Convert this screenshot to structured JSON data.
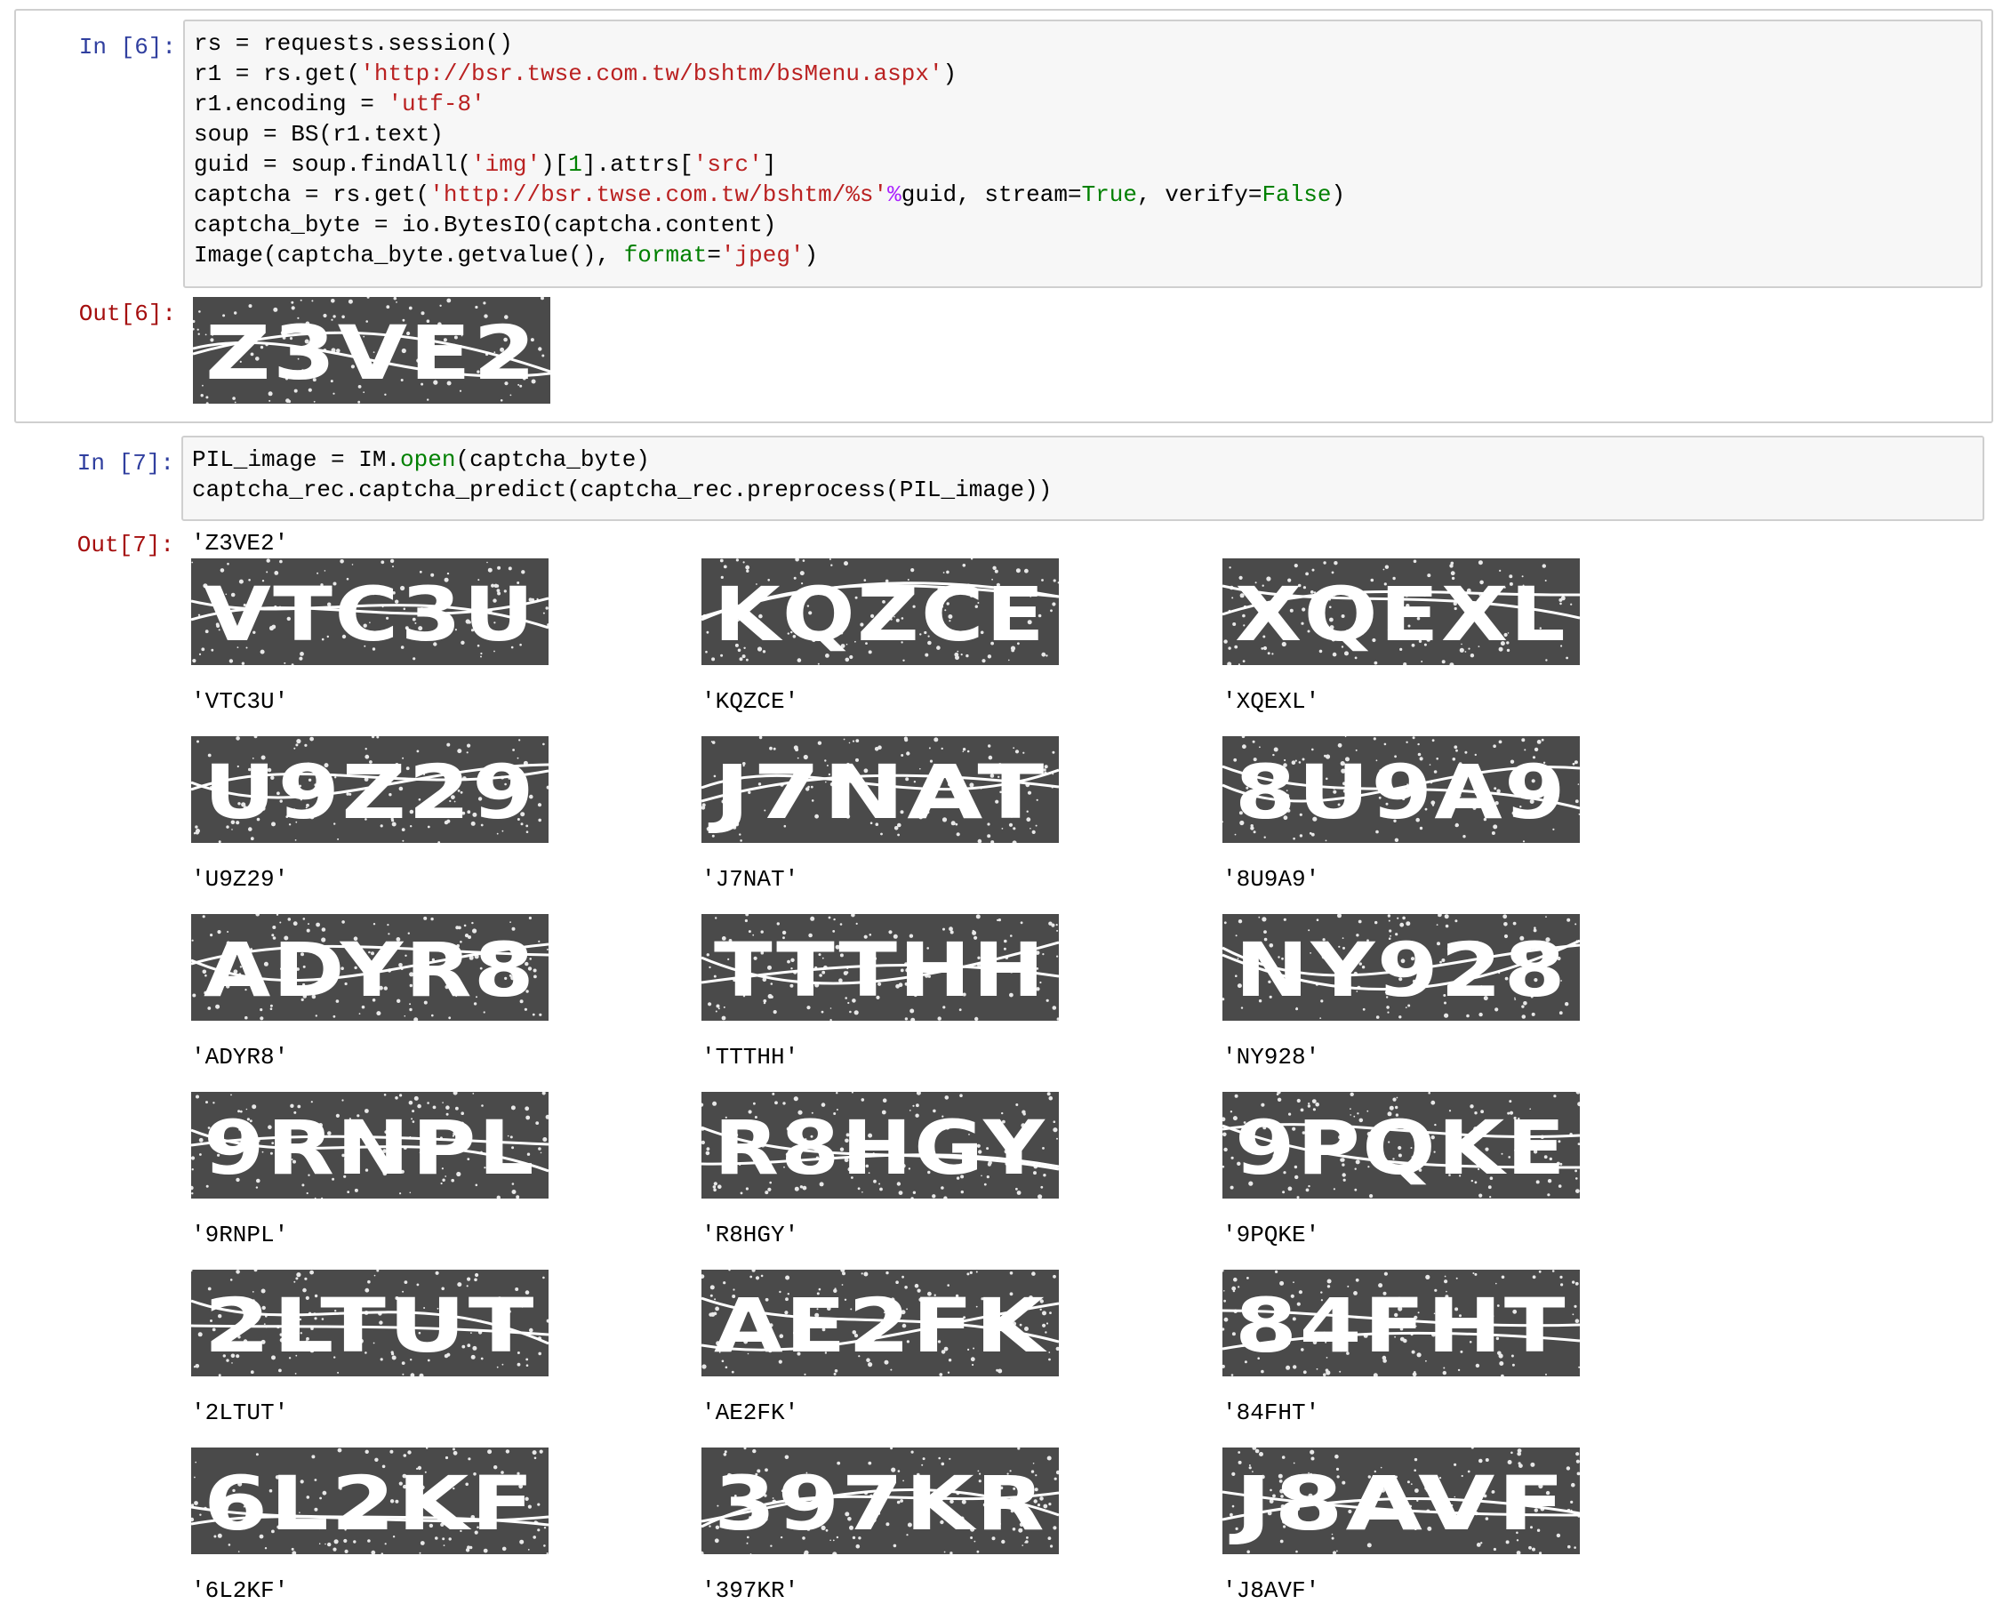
{
  "cell6": {
    "in_prompt": "In [6]:",
    "out_prompt": "Out[6]:",
    "code": [
      [
        {
          "t": "rs = requests.session()",
          "c": "plain"
        }
      ],
      [
        {
          "t": "r1 = rs.get(",
          "c": "plain"
        },
        {
          "t": "'http://bsr.twse.com.tw/bshtm/bsMenu.aspx'",
          "c": "str"
        },
        {
          "t": ")",
          "c": "plain"
        }
      ],
      [
        {
          "t": "r1.encoding = ",
          "c": "plain"
        },
        {
          "t": "'utf-8'",
          "c": "str"
        }
      ],
      [
        {
          "t": "soup = BS(r1.text)",
          "c": "plain"
        }
      ],
      [
        {
          "t": "guid = soup.findAll(",
          "c": "plain"
        },
        {
          "t": "'img'",
          "c": "str"
        },
        {
          "t": ")[",
          "c": "plain"
        },
        {
          "t": "1",
          "c": "num"
        },
        {
          "t": "].attrs[",
          "c": "plain"
        },
        {
          "t": "'src'",
          "c": "str"
        },
        {
          "t": "]",
          "c": "plain"
        }
      ],
      [
        {
          "t": "captcha = rs.get(",
          "c": "plain"
        },
        {
          "t": "'http://bsr.twse.com.tw/bshtm/%s'",
          "c": "str"
        },
        {
          "t": "%",
          "c": "op"
        },
        {
          "t": "guid, stream=",
          "c": "plain"
        },
        {
          "t": "True",
          "c": "kw"
        },
        {
          "t": ", verify=",
          "c": "plain"
        },
        {
          "t": "False",
          "c": "kw"
        },
        {
          "t": ")",
          "c": "plain"
        }
      ],
      [
        {
          "t": "captcha_byte = io.BytesIO(captcha.content)",
          "c": "plain"
        }
      ],
      [
        {
          "t": "Image(captcha_byte.getvalue(), ",
          "c": "plain"
        },
        {
          "t": "format",
          "c": "kw"
        },
        {
          "t": "=",
          "c": "plain"
        },
        {
          "t": "'jpeg'",
          "c": "str"
        },
        {
          "t": ")",
          "c": "plain"
        }
      ]
    ],
    "output_image_text": "Z3VE2"
  },
  "cell7": {
    "in_prompt": "In [7]:",
    "out_prompt": "Out[7]:",
    "code": [
      [
        {
          "t": "PIL_image = IM.",
          "c": "plain"
        },
        {
          "t": "open",
          "c": "kw"
        },
        {
          "t": "(captcha_byte)",
          "c": "plain"
        }
      ],
      [
        {
          "t": "captcha_rec.captcha_predict(captcha_rec.preprocess(PIL_image))",
          "c": "plain"
        }
      ]
    ],
    "output_text": "'Z3VE2'",
    "captchas": [
      {
        "image_text": "VTC3U",
        "label": "'VTC3U'"
      },
      {
        "image_text": "KQZCE",
        "label": "'KQZCE'"
      },
      {
        "image_text": "XQEXL",
        "label": "'XQEXL'"
      },
      {
        "image_text": "U9Z29",
        "label": "'U9Z29'"
      },
      {
        "image_text": "J7NAT",
        "label": "'J7NAT'"
      },
      {
        "image_text": "8U9A9",
        "label": "'8U9A9'"
      },
      {
        "image_text": "ADYR8",
        "label": "'ADYR8'"
      },
      {
        "image_text": "TTTHH",
        "label": "'TTTHH'"
      },
      {
        "image_text": "NY928",
        "label": "'NY928'"
      },
      {
        "image_text": "9RNPL",
        "label": "'9RNPL'"
      },
      {
        "image_text": "R8HGY",
        "label": "'R8HGY'"
      },
      {
        "image_text": "9PQKE",
        "label": "'9PQKE'"
      },
      {
        "image_text": "2LTUT",
        "label": "'2LTUT'"
      },
      {
        "image_text": "AE2FK",
        "label": "'AE2FK'"
      },
      {
        "image_text": "84FHT",
        "label": "'84FHT'"
      },
      {
        "image_text": "6L2KF",
        "label": "'6L2KF'"
      },
      {
        "image_text": "397KR",
        "label": "'397KR'"
      },
      {
        "image_text": "J8AVF",
        "label": "'J8AVF'"
      }
    ]
  },
  "colors": {
    "prompt_in": "#303f9f",
    "prompt_out": "#a50e0e",
    "string": "#ba2121",
    "keyword": "#008000",
    "operator": "#aa22ff",
    "captcha_bg": "#4a4a4a"
  }
}
